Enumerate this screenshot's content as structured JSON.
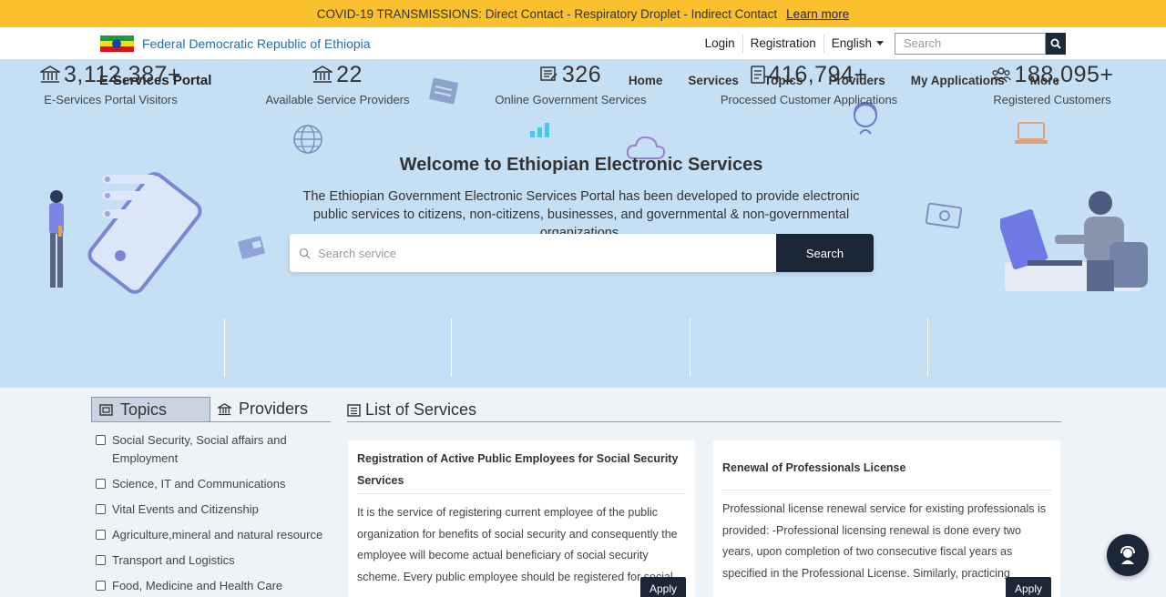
{
  "banner": {
    "text": "COVID-19 TRANSMISSIONS: Direct Contact - Respiratory Droplet - Indirect Contact",
    "link": "Learn more"
  },
  "topbar": {
    "country": "Federal Democratic Republic of Ethiopia",
    "login": "Login",
    "registration": "Registration",
    "language": "English",
    "search_placeholder": "Search"
  },
  "header": {
    "brand": "E-Services Portal",
    "nav": [
      "Home",
      "Services",
      "Topics",
      "Providers",
      "My Applications",
      "More"
    ]
  },
  "hero": {
    "title": "Welcome to Ethiopian Electronic Services",
    "description": "The Ethiopian Government Electronic Services Portal has been developed to provide electronic public services to citizens, non-citizens, businesses, and governmental & non-governmental organizations.",
    "search_placeholder": "Search service",
    "search_button": "Search"
  },
  "stats": [
    {
      "value": "3,112,387+",
      "label": "E-Services Portal Visitors",
      "icon": "bank-icon"
    },
    {
      "value": "22",
      "label": "Available Service Providers",
      "icon": "bank-icon"
    },
    {
      "value": "326",
      "label": "Online Government Services",
      "icon": "services-icon"
    },
    {
      "value": "416,794+",
      "label": "Processed Customer Applications",
      "icon": "document-icon"
    },
    {
      "value": "188,095+",
      "label": "Registered Customers",
      "icon": "users-icon"
    }
  ],
  "sidebar": {
    "tab_topics": "Topics",
    "tab_providers": "Providers",
    "topics": [
      "Social Security, Social affairs and Employment",
      "Science, IT and Communications",
      "Vital Events and Citizenship",
      "Agriculture,mineral and natural resource",
      "Transport and Logistics",
      "Food, Medicine and Health Care"
    ]
  },
  "services": {
    "heading": "List of Services",
    "cards": [
      {
        "title": "Registration of Active Public Employees for Social Security Services",
        "description": "It is the service of registering current employee of the public organization for benefits of social security and consequently the employee will become actual beneficiary of social security scheme. Every public employee should be registered for social",
        "button": "Apply"
      },
      {
        "title": "Renewal of Professionals License",
        "description": "Professional license renewal service for existing professionals is provided: -Professional licensing renewal is done every two years, upon completion of two consecutive fiscal years as specified in the Professional License. Similarly, practicing",
        "button": "Apply"
      }
    ]
  },
  "colors": {
    "banner": "#fbc02d",
    "hero": "#c5dff5",
    "dark": "#1b2636",
    "link": "#1e6fb8"
  }
}
